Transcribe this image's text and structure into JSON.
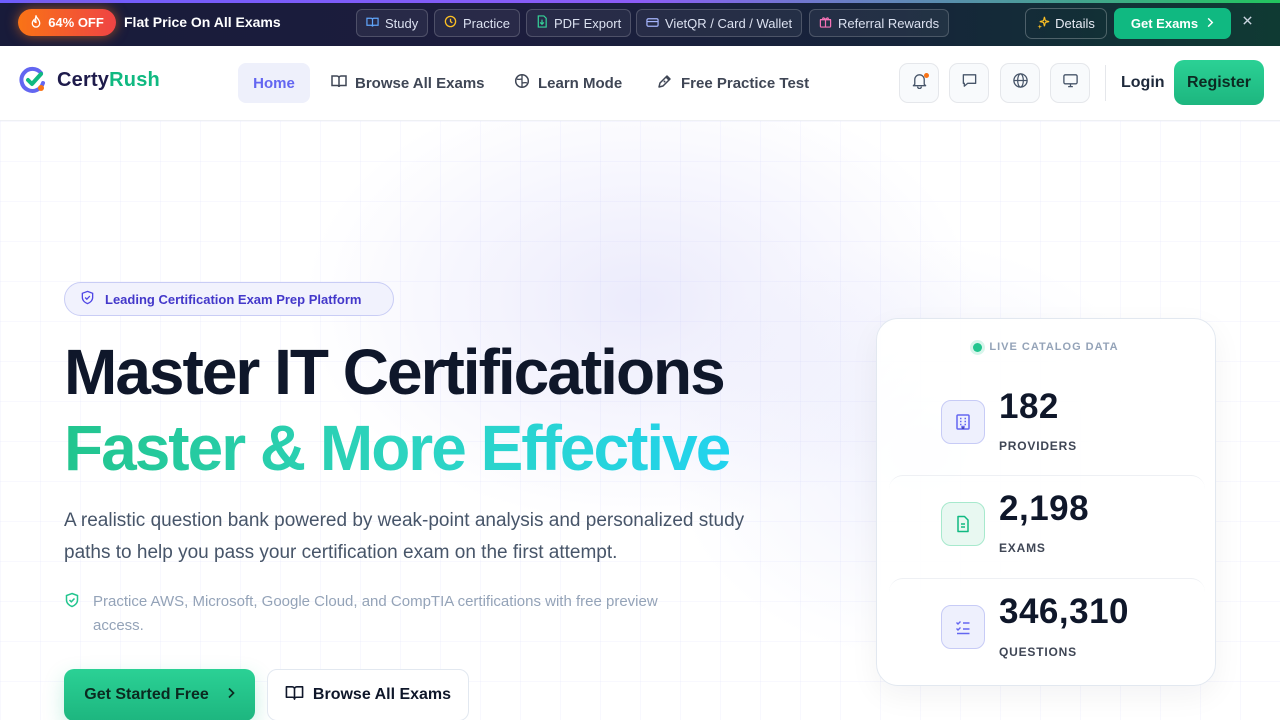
{
  "promo": {
    "badge": "64% OFF",
    "text": "Flat Price On All Exams",
    "chips": [
      {
        "label": "Study",
        "icon": "book-icon"
      },
      {
        "label": "Practice",
        "icon": "clock-icon"
      },
      {
        "label": "PDF Export",
        "icon": "file-download-icon"
      },
      {
        "label": "VietQR / Card / Wallet",
        "icon": "card-icon"
      },
      {
        "label": "Referral Rewards",
        "icon": "gift-icon"
      }
    ],
    "details_label": "Details",
    "get_label": "Get Exams",
    "colors": {
      "badge": "#f97316",
      "get": "#10b981"
    }
  },
  "header": {
    "logo_a": "Certy",
    "logo_b": "Rush",
    "nav": [
      {
        "label": "Home",
        "icon": ""
      },
      {
        "label": "Browse All Exams",
        "icon": "book-open-icon"
      },
      {
        "label": "Learn Mode",
        "icon": "brain-icon"
      },
      {
        "label": "Free Practice Test",
        "icon": "pen-icon"
      }
    ],
    "icon_buttons": [
      "bell-icon",
      "chat-icon",
      "globe-icon",
      "monitor-icon"
    ],
    "login": "Login",
    "register": "Register",
    "colors": {
      "accent": "#6366f1",
      "brand_green": "#22c58e"
    }
  },
  "hero": {
    "tag": "Leading Certification Exam Prep Platform",
    "title_line1": "Master IT Certifications",
    "title_line2": "Faster & More Effective",
    "lead": "A realistic question bank powered by weak-point analysis and personalized study paths to help you pass your certification exam on the first attempt.",
    "note": "Practice AWS, Microsoft, Google Cloud, and CompTIA certifications with free preview access.",
    "cta_primary": "Get Started Free",
    "cta_secondary": "Browse All Exams"
  },
  "stats": {
    "heading": "LIVE CATALOG DATA",
    "items": [
      {
        "value": "182",
        "label": "PROVIDERS",
        "icon": "building-icon",
        "color": "#6366f1"
      },
      {
        "value": "2,198",
        "label": "EXAMS",
        "icon": "document-icon",
        "color": "#10b981"
      },
      {
        "value": "346,310",
        "label": "QUESTIONS",
        "icon": "checklist-icon",
        "color": "#6366f1"
      }
    ]
  }
}
